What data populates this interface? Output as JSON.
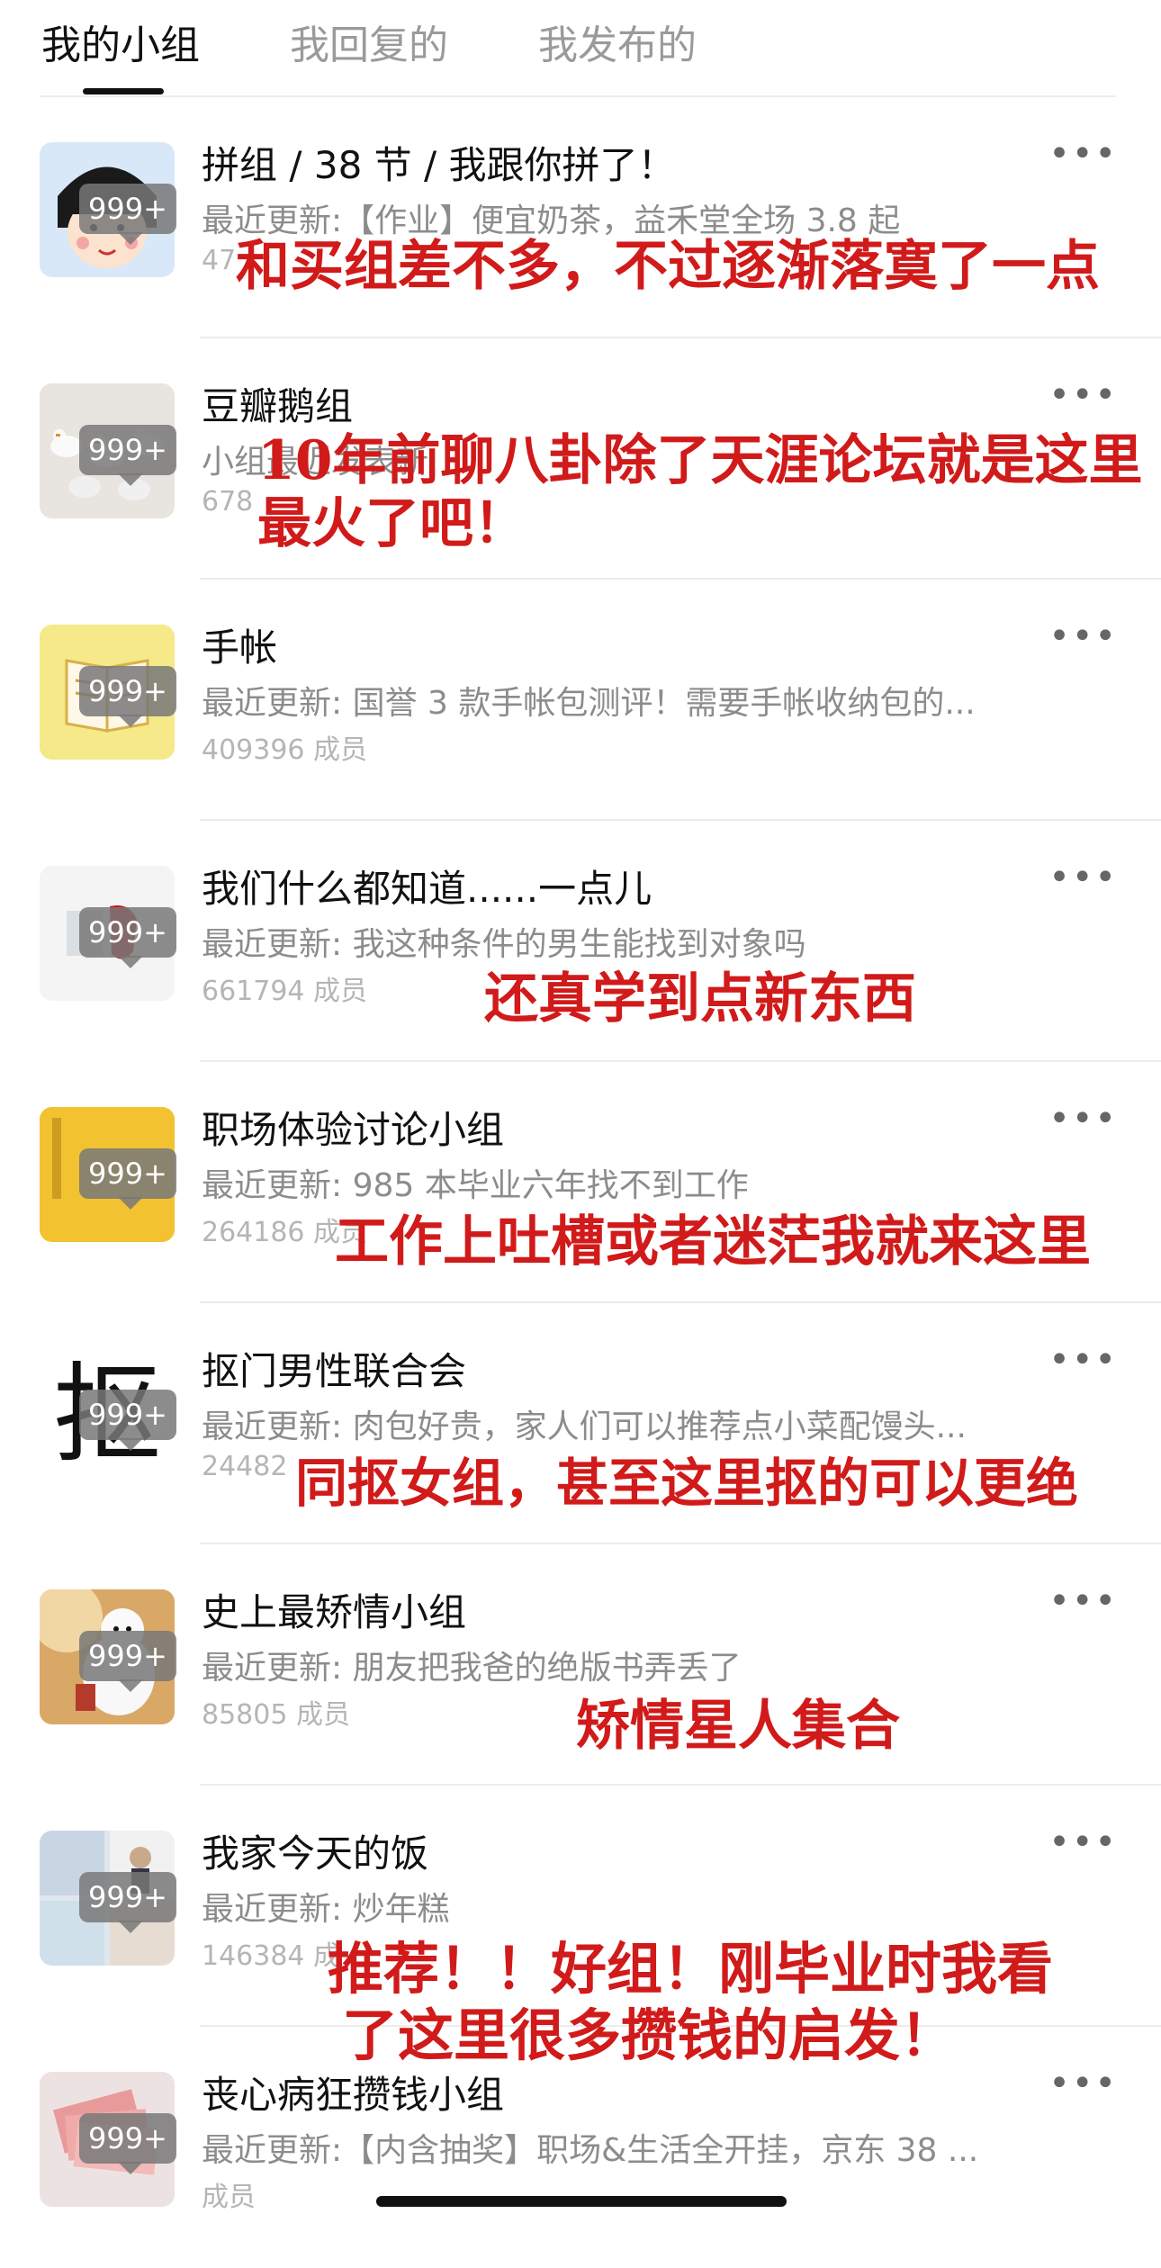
{
  "tabs": [
    "我的小组",
    "我回复的",
    "我发布的"
  ],
  "groups": [
    {
      "title": "拼组 / 38 节 / 我跟你拼了！",
      "latest": "最近更新:【作业】便宜奶茶，益禾堂全场 3.8 起",
      "members": "47",
      "badge": "999+"
    },
    {
      "title": "豆瓣鹅组",
      "latest": "小组最近发表新",
      "members": "678",
      "badge": "999+"
    },
    {
      "title": "手帐",
      "latest": "最近更新: 国誉 3 款手帐包测评！需要手帐收纳包的...",
      "members": "409396 成员",
      "badge": "999+"
    },
    {
      "title": "我们什么都知道......一点儿",
      "latest": "最近更新: 我这种条件的男生能找到对象吗",
      "members": "661794 成员",
      "badge": "999+"
    },
    {
      "title": "职场体验讨论小组",
      "latest": "最近更新: 985 本毕业六年找不到工作",
      "members": "264186 成员",
      "badge": "999+"
    },
    {
      "title": "抠门男性联合会",
      "latest": "最近更新: 肉包好贵，家人们可以推荐点小菜配馒头...",
      "members": "24482",
      "badge": "999+"
    },
    {
      "title": "史上最矫情小组",
      "latest": "最近更新: 朋友把我爸的绝版书弄丢了",
      "members": "85805 成员",
      "badge": "999+"
    },
    {
      "title": "我家今天的饭",
      "latest": "最近更新: 炒年糕",
      "members": "146384 成",
      "badge": "999+"
    },
    {
      "title": "丧心病狂攒钱小组",
      "latest": "最近更新:【内含抽奖】职场&生活全开挂，京东 38 ...",
      "members": "成员",
      "badge": "999+"
    }
  ],
  "more_glyph": "•••",
  "annotations": [
    "和买组差不多，不过逐渐落寞了一点",
    "10年前聊八卦除了天涯论坛就是这里",
    "最火了吧！",
    "还真学到点新东西",
    "工作上吐槽或者迷茫我就来这里",
    "同抠女组，甚至这里抠的可以更绝",
    "矫情星人集合",
    "推荐！！好组！刚毕业时我看",
    "了这里很多攒钱的启发！"
  ],
  "avatar_icon_text": "抠",
  "colors": {
    "annotation": "#d11a1a",
    "badge": "#787878",
    "tab_active": "#111111",
    "tab_inactive": "#9a9a9a"
  }
}
